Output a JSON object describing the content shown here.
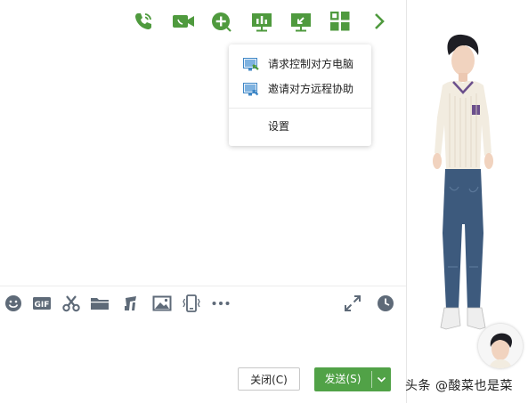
{
  "colors": {
    "accent_green": "#4f9a3e",
    "toolbar_gray": "#5e6a78",
    "send_button": "#51a247",
    "menu_icon_blue": "#3f87c6"
  },
  "toolbar": {
    "items": [
      {
        "name": "voice-call",
        "icon": "phone-icon"
      },
      {
        "name": "video-call",
        "icon": "video-camera-icon"
      },
      {
        "name": "add-member",
        "icon": "plus-circle-icon"
      },
      {
        "name": "presentation",
        "icon": "presentation-icon"
      },
      {
        "name": "remote-assist",
        "icon": "remote-screen-icon"
      },
      {
        "name": "apps",
        "icon": "grid-icon"
      },
      {
        "name": "more",
        "icon": "chevron-right-icon"
      }
    ]
  },
  "remote_menu": {
    "items": [
      {
        "label": "请求控制对方电脑",
        "icon": "request-control-icon"
      },
      {
        "label": "邀请对方远程协助",
        "icon": "invite-assist-icon"
      }
    ],
    "settings_label": "设置"
  },
  "input_toolbar": {
    "left_icons": [
      "emoji-icon",
      "gif-icon",
      "scissors-icon",
      "folder-icon",
      "music-note-icon",
      "image-icon",
      "shake-icon",
      "more-dots-icon"
    ],
    "right_icons": [
      "expand-icon",
      "history-clock-icon"
    ]
  },
  "buttons": {
    "close_label": "关闭(C)",
    "send_label": "发送(S)"
  },
  "watermark": "头条 @酸菜也是菜"
}
